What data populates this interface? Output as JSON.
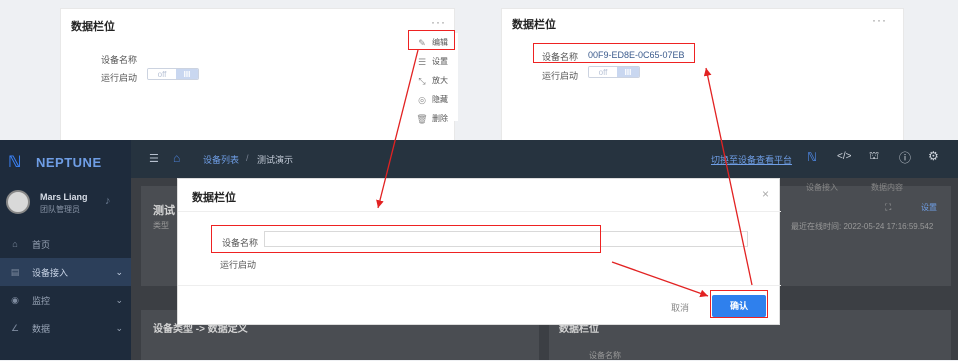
{
  "left_card": {
    "title": "数据栏位",
    "more": "···",
    "field_device_name": "设备名称",
    "field_run_start": "运行启动",
    "toggle_off": "off",
    "toggle_on": "III",
    "menu": [
      {
        "label": "编辑",
        "icon": "edit-icon",
        "glyph": "✎"
      },
      {
        "label": "设置",
        "icon": "settings-icon",
        "glyph": "☰"
      },
      {
        "label": "放大",
        "icon": "expand-icon",
        "glyph": "⤡"
      },
      {
        "label": "隐藏",
        "icon": "hide-icon",
        "glyph": "◎"
      },
      {
        "label": "删除",
        "icon": "delete-icon",
        "glyph": "🗑"
      }
    ]
  },
  "right_card": {
    "title": "数据栏位",
    "more": "···",
    "field_device_name": "设备名称",
    "device_name_value": "00F9-ED8E-0C65-07EB",
    "field_run_start": "运行启动",
    "toggle_off": "off",
    "toggle_on": "III"
  },
  "app": {
    "logo": "NEPTUNE",
    "user_name": "Mars Liang",
    "user_role": "团队管理员",
    "sidebar": [
      {
        "label": "首页",
        "icon": "home-icon",
        "glyph": "⌂"
      },
      {
        "label": "设备接入",
        "icon": "device-icon",
        "glyph": "▤",
        "active": true
      },
      {
        "label": "监控",
        "icon": "monitor-icon",
        "glyph": "◉"
      },
      {
        "label": "数据",
        "icon": "data-icon",
        "glyph": "∠"
      }
    ],
    "breadcrumb": [
      "设备列表",
      "测试演示"
    ],
    "header_link": "切换至设备查看平台",
    "bg_title": "测试",
    "bg_type": "类型",
    "bg_settings": "设置",
    "bg_online": "最近在线时间: 2022-05-24 17:16:59.542",
    "bg_tab1": "设备接入",
    "bg_tab2": "数据内容",
    "bg_section_left": "设备类型 -> 数据定义",
    "bg_section_right": "数据栏位",
    "bg_device_name": "设备名称"
  },
  "modal": {
    "title": "数据栏位",
    "close": "×",
    "field_device_name": "设备名称",
    "device_name_value": "",
    "field_run_start": "运行启动",
    "cancel": "取消",
    "confirm": "确认"
  },
  "colors": {
    "annotation": "#e22222",
    "accent": "#2f80ed",
    "sidebar": "#1e2b3c"
  }
}
